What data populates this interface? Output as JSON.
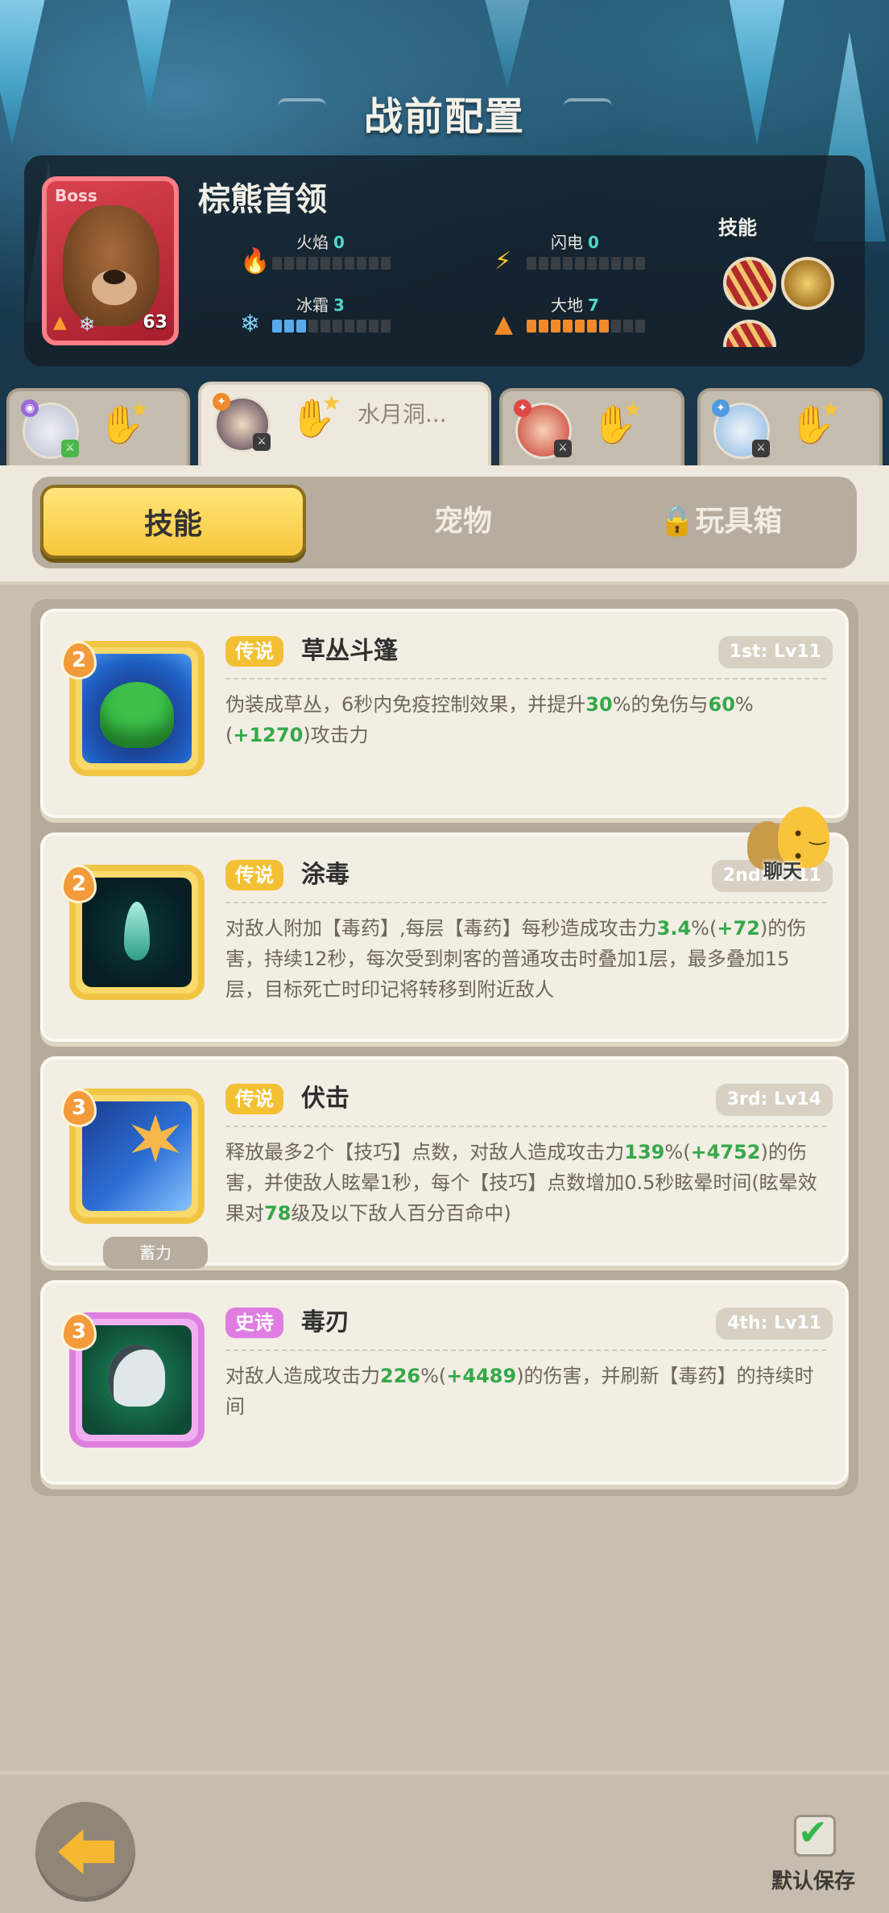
{
  "header": {
    "title": "战前配置"
  },
  "boss": {
    "tag": "Boss",
    "name": "棕熊首领",
    "level": "63",
    "stats": {
      "fire": {
        "label": "火焰",
        "value": "0"
      },
      "lightning": {
        "label": "闪电",
        "value": "0"
      },
      "frost": {
        "label": "冰霜",
        "value": "3"
      },
      "earth": {
        "label": "大地",
        "value": "7"
      }
    },
    "skills_label": "技能"
  },
  "hero_tabs": [
    {
      "label": "",
      "active": false
    },
    {
      "label": "水月洞...",
      "active": true
    },
    {
      "label": "",
      "active": false
    },
    {
      "label": "",
      "active": false
    }
  ],
  "tabs": {
    "skills": "技能",
    "pets": "宠物",
    "toys": "玩具箱",
    "toys_icon": "lock-icon"
  },
  "skills": [
    {
      "level_badge": "2",
      "rarity": "传说",
      "name": "草丛斗篷",
      "slot": "1st: Lv11",
      "desc_parts": [
        "伪装成草丛，6秒内免疫控制效果，并提升",
        "30",
        "%的免伤与",
        "60",
        "%(",
        "+1270",
        ")攻击力"
      ]
    },
    {
      "level_badge": "2",
      "rarity": "传说",
      "name": "涂毒",
      "slot": "2nd: Lv11",
      "desc_parts": [
        "对敌人附加【毒药】,每层【毒药】每秒造成攻击力",
        "3.4",
        "%(",
        "+72",
        ")的伤害，持续12秒，每次受到刺客的普通攻击时叠加1层，最多叠加15层，目标死亡时印记将转移到附近敌人"
      ]
    },
    {
      "level_badge": "3",
      "rarity": "传说",
      "name": "伏击",
      "slot": "3rd: Lv14",
      "charge_tag": "蓄力",
      "desc_parts": [
        "释放最多2个【技巧】点数，对敌人造成攻击力",
        "139",
        "%(",
        "+4752",
        ")的伤害，并使敌人眩晕1秒，每个【技巧】点数增加0.5秒眩晕时间(眩晕效果对",
        "78",
        "级及以下敌人百分百命中)"
      ]
    },
    {
      "level_badge": "3",
      "rarity": "史诗",
      "name": "毒刃",
      "slot": "4th: Lv11",
      "desc_parts": [
        "对敌人造成攻击力",
        "226",
        "%(",
        "+4489",
        ")的伤害，并刷新【毒药】的持续时间"
      ]
    }
  ],
  "chat": {
    "label": "聊天"
  },
  "footer": {
    "save_label": "默认保存"
  },
  "colors": {
    "accent_yellow": "#f8c73c",
    "legend": "#f2c032",
    "epic": "#df7de2",
    "highlight_green": "#35a84a",
    "boss_red": "#d9434f"
  }
}
